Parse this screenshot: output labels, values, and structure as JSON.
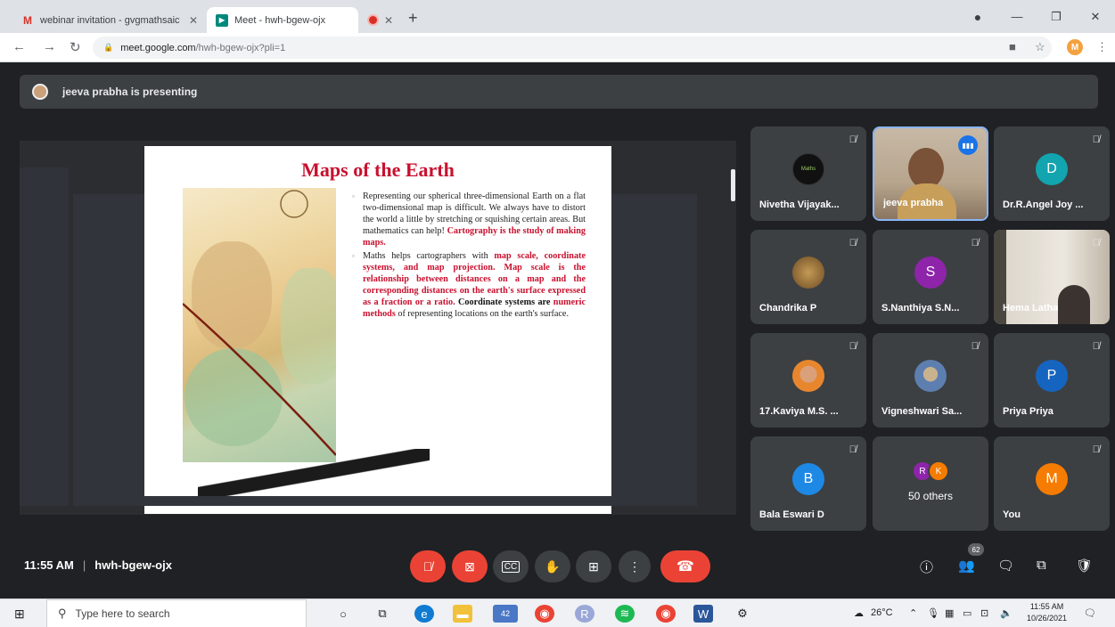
{
  "browser": {
    "tabs": [
      {
        "title": "webinar invitation - gvgmathsaic",
        "favicon": "gmail-icon"
      },
      {
        "title": "Meet - hwh-bgew-ojx",
        "favicon": "meet-icon"
      },
      {
        "title": "",
        "favicon": "recording-icon"
      }
    ],
    "address": {
      "domain": "meet.google.com",
      "path": "/hwh-bgew-ojx?pli=1"
    },
    "profile_initial": "M"
  },
  "presenter_banner": "jeeva prabha is presenting",
  "slide": {
    "title": "Maps of the Earth",
    "p1_pre": "Representing our spherical three-dimensional Earth on a flat two-dimensional map is difficult. We always have to distort the world a little by stretching or squishing certain areas. But mathematics can help! ",
    "p1_hl": "Cartography is the study of making maps.",
    "p2_pre": "Maths helps cartographers with ",
    "p2_hl1": "map scale, coordinate systems, and map projection. Map scale is the relationship between distances on a map and the corresponding distances on the earth's surface expressed as a fraction or a ratio.",
    "p2_bk": " Coordinate systems are ",
    "p2_hl2": "numeric methods",
    "p2_post": " of representing locations on the earth's surface."
  },
  "participants": [
    {
      "name": "Nivetha Vijayak...",
      "avatar": "logo",
      "color": "#111111"
    },
    {
      "name": "jeeva prabha",
      "avatar": "video"
    },
    {
      "name": "Dr.R.Angel Joy ...",
      "initial": "D",
      "color": "#12a4af"
    },
    {
      "name": "Chandrika P",
      "avatar": "photo"
    },
    {
      "name": "S.Nanthiya S.N...",
      "initial": "S",
      "color": "#8e24aa"
    },
    {
      "name": "Hema Latha",
      "avatar": "video"
    },
    {
      "name": "17.Kaviya M.S. ...",
      "avatar": "photo"
    },
    {
      "name": "Vigneshwari Sa...",
      "avatar": "photo"
    },
    {
      "name": "Priya Priya",
      "initial": "P",
      "color": "#1565c0"
    },
    {
      "name": "Bala Eswari D",
      "initial": "B",
      "color": "#1e88e5"
    },
    {
      "name": "50 others",
      "initials": [
        "R",
        "K"
      ],
      "colors": [
        "#8e24aa",
        "#f57c00"
      ]
    },
    {
      "name": "You",
      "initial": "M",
      "color": "#f57c00"
    }
  ],
  "meeting": {
    "time": "11:55 AM",
    "code": "hwh-bgew-ojx",
    "participant_count": "62"
  },
  "taskbar": {
    "search_placeholder": "Type here to search",
    "mail_badge": "42",
    "weather": "26°C",
    "time": "11:55 AM",
    "date": "10/26/2021"
  }
}
